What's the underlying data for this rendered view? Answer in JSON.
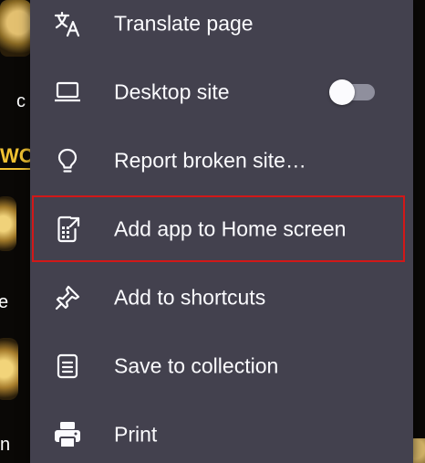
{
  "background": {
    "fragments": [
      "c",
      "WO",
      "e",
      "n"
    ]
  },
  "menu": {
    "items": [
      {
        "label": "Translate page",
        "icon": "translate-icon"
      },
      {
        "label": "Desktop site",
        "icon": "laptop-icon",
        "toggle": false
      },
      {
        "label": "Report broken site…",
        "icon": "lightbulb-icon"
      },
      {
        "label": "Add app to Home screen",
        "icon": "add-to-homescreen-icon",
        "highlighted": true
      },
      {
        "label": "Add to shortcuts",
        "icon": "pin-icon"
      },
      {
        "label": "Save to collection",
        "icon": "collection-icon"
      },
      {
        "label": "Print",
        "icon": "printer-icon"
      }
    ]
  },
  "colors": {
    "menu_background": "#43414e",
    "text": "#fbfbfe",
    "highlight": "#d21818",
    "accent_gold": "#f1c232"
  }
}
